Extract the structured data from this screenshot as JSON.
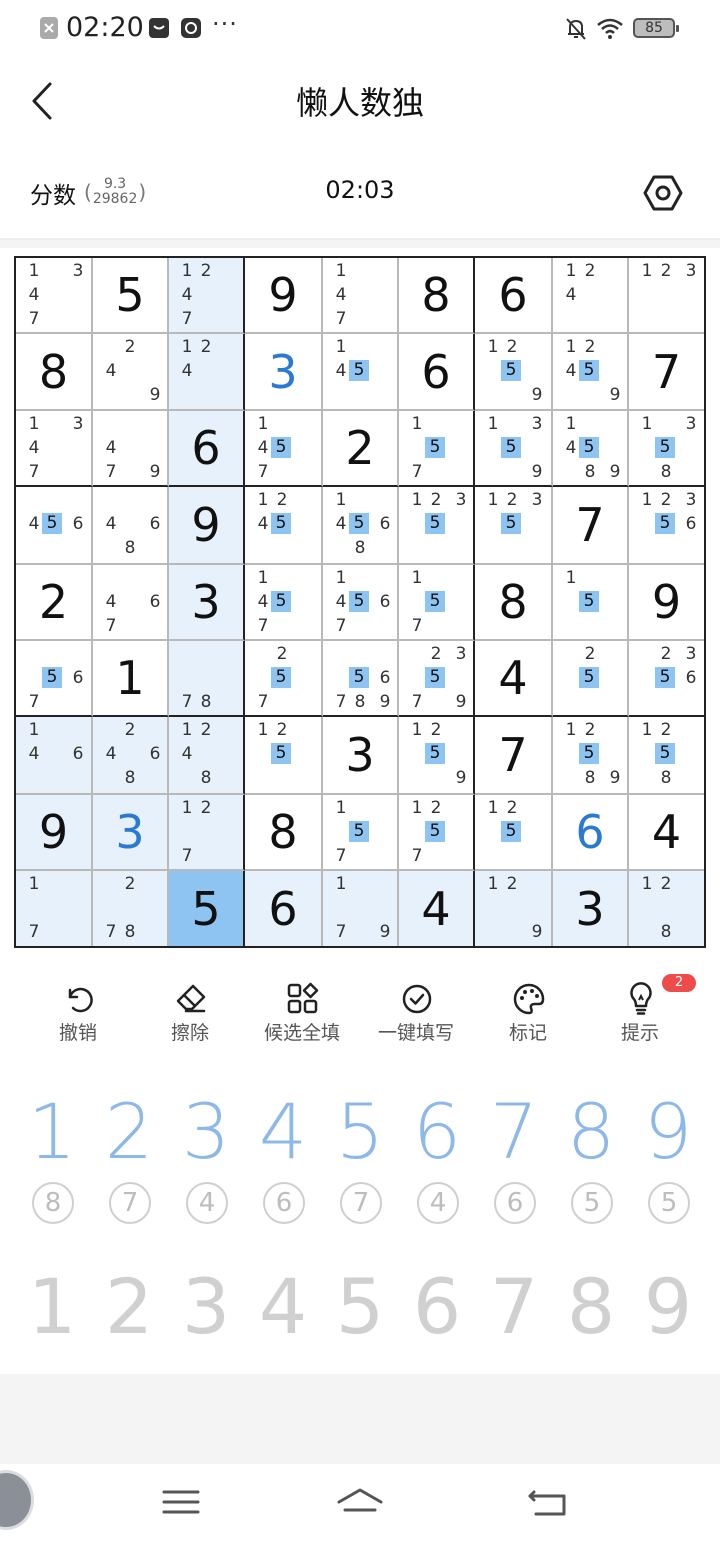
{
  "status_bar": {
    "time": "02:20",
    "battery": "85",
    "more": "···"
  },
  "header": {
    "title": "懒人数独"
  },
  "info": {
    "score_label": "分数",
    "score_open": "(",
    "score_top": "9.3",
    "score_bottom": "29862",
    "score_close": ")",
    "timer": "02:03"
  },
  "board": {
    "selected": [
      8,
      2
    ],
    "highlighted_rows": [
      8
    ],
    "highlighted_cols": [
      2
    ],
    "highlighted_box": 6,
    "cells": [
      [
        {
          "c": [
            1,
            3,
            4,
            7
          ]
        },
        {
          "v": 5
        },
        {
          "c": [
            1,
            2,
            4,
            7
          ]
        },
        {
          "v": 9
        },
        {
          "c": [
            1,
            4,
            7
          ]
        },
        {
          "v": 8
        },
        {
          "v": 6
        },
        {
          "c": [
            1,
            2,
            4
          ]
        },
        {
          "c": [
            1,
            2,
            3
          ]
        }
      ],
      [
        {
          "v": 8
        },
        {
          "c": [
            2,
            4,
            9
          ]
        },
        {
          "c": [
            1,
            2,
            4
          ]
        },
        {
          "v": 3,
          "u": true
        },
        {
          "c": [
            1,
            4,
            5
          ],
          "m": [
            5
          ]
        },
        {
          "v": 6
        },
        {
          "c": [
            1,
            2,
            5,
            9
          ],
          "m": [
            5
          ]
        },
        {
          "c": [
            1,
            2,
            4,
            5,
            9
          ],
          "m": [
            5
          ]
        },
        {
          "v": 7
        }
      ],
      [
        {
          "c": [
            1,
            3,
            4,
            7
          ]
        },
        {
          "c": [
            4,
            7,
            9
          ]
        },
        {
          "v": 6
        },
        {
          "c": [
            1,
            4,
            5,
            7
          ],
          "m": [
            5
          ]
        },
        {
          "v": 2
        },
        {
          "c": [
            1,
            5,
            7
          ],
          "m": [
            5
          ]
        },
        {
          "c": [
            1,
            3,
            5,
            9
          ],
          "m": [
            5
          ]
        },
        {
          "c": [
            1,
            4,
            5,
            8,
            9
          ],
          "m": [
            5
          ]
        },
        {
          "c": [
            1,
            3,
            5,
            8
          ],
          "m": [
            5
          ]
        }
      ],
      [
        {
          "c": [
            4,
            5,
            6
          ],
          "m": [
            5
          ]
        },
        {
          "c": [
            4,
            6,
            8
          ]
        },
        {
          "v": 9
        },
        {
          "c": [
            1,
            2,
            4,
            5
          ],
          "m": [
            5
          ]
        },
        {
          "c": [
            1,
            4,
            5,
            6,
            8
          ],
          "m": [
            5
          ]
        },
        {
          "c": [
            1,
            2,
            3,
            5
          ],
          "m": [
            5
          ]
        },
        {
          "c": [
            1,
            2,
            3,
            5
          ],
          "m": [
            5
          ]
        },
        {
          "v": 7
        },
        {
          "c": [
            1,
            2,
            3,
            5,
            6
          ],
          "m": [
            5
          ]
        }
      ],
      [
        {
          "v": 2
        },
        {
          "c": [
            4,
            6,
            7
          ]
        },
        {
          "v": 3
        },
        {
          "c": [
            1,
            4,
            5,
            7
          ],
          "m": [
            5
          ]
        },
        {
          "c": [
            1,
            4,
            5,
            6,
            7
          ],
          "m": [
            5
          ]
        },
        {
          "c": [
            1,
            5,
            7
          ],
          "m": [
            5
          ]
        },
        {
          "v": 8
        },
        {
          "c": [
            1,
            5
          ],
          "m": [
            5
          ]
        },
        {
          "v": 9
        }
      ],
      [
        {
          "c": [
            5,
            6,
            7
          ],
          "m": [
            5
          ]
        },
        {
          "v": 1
        },
        {
          "c": [
            7,
            8
          ]
        },
        {
          "c": [
            2,
            5,
            7
          ],
          "m": [
            5
          ]
        },
        {
          "c": [
            5,
            6,
            7,
            8,
            9
          ],
          "m": [
            5
          ]
        },
        {
          "c": [
            2,
            3,
            5,
            7,
            9
          ],
          "m": [
            5
          ]
        },
        {
          "v": 4
        },
        {
          "c": [
            2,
            5
          ],
          "m": [
            5
          ]
        },
        {
          "c": [
            2,
            3,
            5,
            6
          ],
          "m": [
            5
          ]
        }
      ],
      [
        {
          "c": [
            1,
            4,
            6
          ]
        },
        {
          "c": [
            2,
            4,
            6,
            8
          ]
        },
        {
          "c": [
            1,
            2,
            4,
            8
          ]
        },
        {
          "c": [
            1,
            2,
            5
          ],
          "m": [
            5
          ]
        },
        {
          "v": 3
        },
        {
          "c": [
            1,
            2,
            5,
            9
          ],
          "m": [
            5
          ]
        },
        {
          "v": 7
        },
        {
          "c": [
            1,
            2,
            5,
            8,
            9
          ],
          "m": [
            5
          ]
        },
        {
          "c": [
            1,
            2,
            5,
            8
          ],
          "m": [
            5
          ]
        }
      ],
      [
        {
          "v": 9
        },
        {
          "v": 3,
          "u": true
        },
        {
          "c": [
            1,
            2,
            7
          ]
        },
        {
          "v": 8
        },
        {
          "c": [
            1,
            5,
            7
          ],
          "m": [
            5
          ]
        },
        {
          "c": [
            1,
            2,
            5,
            7
          ],
          "m": [
            5
          ]
        },
        {
          "c": [
            1,
            2,
            5
          ],
          "m": [
            5
          ]
        },
        {
          "v": 6,
          "u": true
        },
        {
          "v": 4
        }
      ],
      [
        {
          "c": [
            1,
            7
          ]
        },
        {
          "c": [
            2,
            7,
            8
          ]
        },
        {
          "v": 5
        },
        {
          "v": 6
        },
        {
          "c": [
            1,
            7,
            9
          ]
        },
        {
          "v": 4
        },
        {
          "c": [
            1,
            2,
            9
          ]
        },
        {
          "v": 3
        },
        {
          "c": [
            1,
            2,
            8
          ]
        }
      ]
    ]
  },
  "tools": [
    {
      "label": "撤销",
      "icon": "undo-icon"
    },
    {
      "label": "擦除",
      "icon": "eraser-icon"
    },
    {
      "label": "候选全填",
      "icon": "fill-candidates-icon"
    },
    {
      "label": "一键填写",
      "icon": "check-circle-icon"
    },
    {
      "label": "标记",
      "icon": "palette-icon"
    },
    {
      "label": "提示",
      "icon": "lightbulb-icon",
      "badge": "2"
    }
  ],
  "numpad": [
    {
      "digit": "1",
      "remaining": "8"
    },
    {
      "digit": "2",
      "remaining": "7"
    },
    {
      "digit": "3",
      "remaining": "4"
    },
    {
      "digit": "4",
      "remaining": "6"
    },
    {
      "digit": "5",
      "remaining": "7"
    },
    {
      "digit": "6",
      "remaining": "4"
    },
    {
      "digit": "7",
      "remaining": "6"
    },
    {
      "digit": "8",
      "remaining": "5"
    },
    {
      "digit": "9",
      "remaining": "5"
    }
  ],
  "candidate_pad": [
    "1",
    "2",
    "3",
    "4",
    "5",
    "6",
    "7",
    "8",
    "9"
  ],
  "colors": {
    "selected": "#8ec4f2",
    "highlight": "#e6f1fb",
    "user_digit": "#2a7ad2",
    "numpad": "#8db8ea",
    "badge": "#ee4b4b"
  }
}
